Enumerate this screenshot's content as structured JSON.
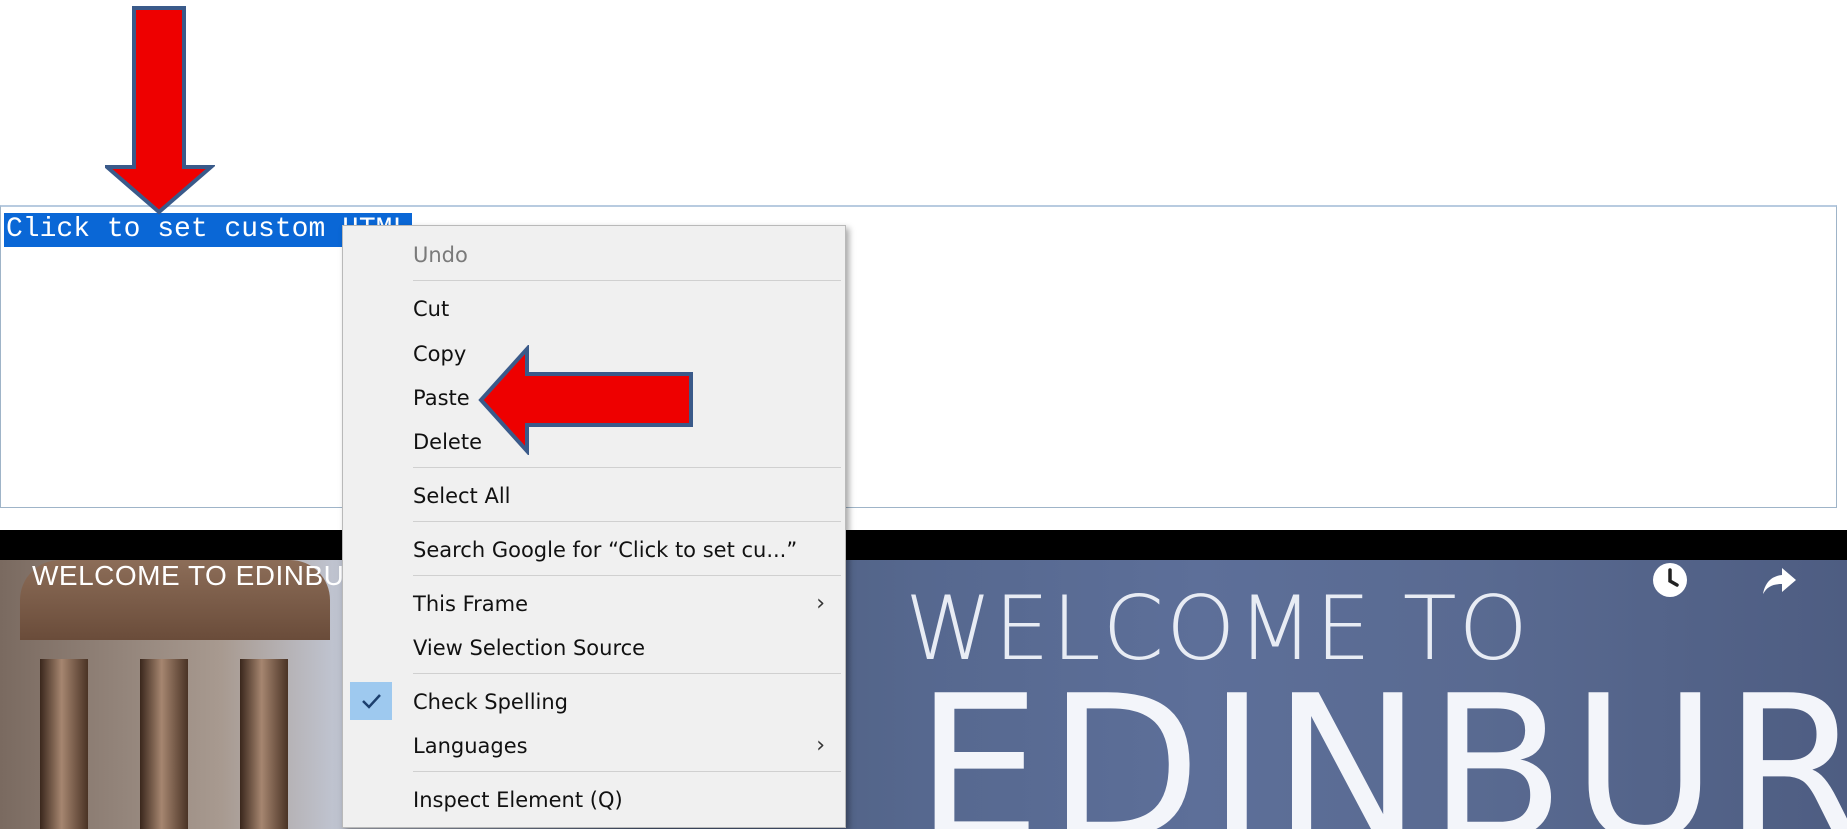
{
  "editor": {
    "text": "Click to set custom HTML"
  },
  "video": {
    "title": "WELCOME TO EDINBURGH",
    "overlay_line1": "WELCOME TO",
    "overlay_line2": "EDINBURGH",
    "icons": [
      "clock-icon",
      "share-icon"
    ]
  },
  "context_menu": {
    "undo": "Undo",
    "cut": "Cut",
    "copy": "Copy",
    "paste": "Paste",
    "delete": "Delete",
    "select_all": "Select All",
    "search": "Search Google for “Click to set cu...”",
    "this_frame": "This Frame",
    "view_selection_source": "View Selection Source",
    "check_spelling": "Check Spelling",
    "check_spelling_checked": true,
    "languages": "Languages",
    "inspect_element": "Inspect Element (Q)",
    "submenu_arrow": "›"
  },
  "annotation_colors": {
    "arrow_fill": "#ee0000",
    "arrow_border": "#3a5a8a"
  }
}
